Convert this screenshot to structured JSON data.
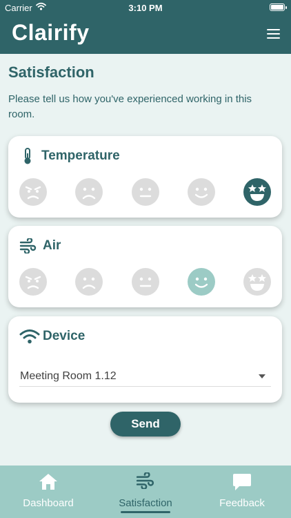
{
  "status_bar": {
    "carrier": "Carrier",
    "time": "3:10 PM"
  },
  "header": {
    "brand": "Clairify"
  },
  "page": {
    "title": "Satisfaction",
    "intro": "Please tell us how you've experienced working in this room."
  },
  "cards": {
    "temperature": {
      "title": "Temperature",
      "icon": "thermometer-icon",
      "selected_rating": 5
    },
    "air": {
      "title": "Air",
      "icon": "wind-icon",
      "selected_rating": 4
    },
    "device": {
      "title": "Device",
      "icon": "wifi-icon",
      "selected_value": "Meeting Room 1.12"
    }
  },
  "send_label": "Send",
  "nav": {
    "items": [
      {
        "label": "Dashboard",
        "icon": "home-icon"
      },
      {
        "label": "Satisfaction",
        "icon": "wind-icon",
        "active": true
      },
      {
        "label": "Feedback",
        "icon": "chat-bubble-icon"
      }
    ]
  },
  "colors": {
    "primary": "#2f6468",
    "accent_light": "#9ccbc5",
    "face_inactive": "#dcdcdc",
    "background": "#eaf3f2"
  }
}
